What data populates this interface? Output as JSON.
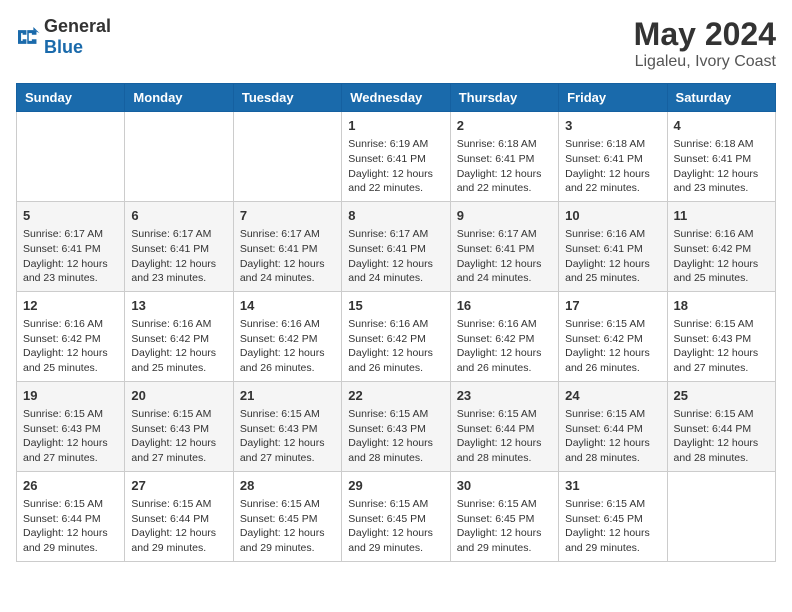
{
  "header": {
    "logo_general": "General",
    "logo_blue": "Blue",
    "month": "May 2024",
    "location": "Ligaleu, Ivory Coast"
  },
  "days_of_week": [
    "Sunday",
    "Monday",
    "Tuesday",
    "Wednesday",
    "Thursday",
    "Friday",
    "Saturday"
  ],
  "weeks": [
    [
      {
        "day": "",
        "info": ""
      },
      {
        "day": "",
        "info": ""
      },
      {
        "day": "",
        "info": ""
      },
      {
        "day": "1",
        "info": "Sunrise: 6:19 AM\nSunset: 6:41 PM\nDaylight: 12 hours\nand 22 minutes."
      },
      {
        "day": "2",
        "info": "Sunrise: 6:18 AM\nSunset: 6:41 PM\nDaylight: 12 hours\nand 22 minutes."
      },
      {
        "day": "3",
        "info": "Sunrise: 6:18 AM\nSunset: 6:41 PM\nDaylight: 12 hours\nand 22 minutes."
      },
      {
        "day": "4",
        "info": "Sunrise: 6:18 AM\nSunset: 6:41 PM\nDaylight: 12 hours\nand 23 minutes."
      }
    ],
    [
      {
        "day": "5",
        "info": "Sunrise: 6:17 AM\nSunset: 6:41 PM\nDaylight: 12 hours\nand 23 minutes."
      },
      {
        "day": "6",
        "info": "Sunrise: 6:17 AM\nSunset: 6:41 PM\nDaylight: 12 hours\nand 23 minutes."
      },
      {
        "day": "7",
        "info": "Sunrise: 6:17 AM\nSunset: 6:41 PM\nDaylight: 12 hours\nand 24 minutes."
      },
      {
        "day": "8",
        "info": "Sunrise: 6:17 AM\nSunset: 6:41 PM\nDaylight: 12 hours\nand 24 minutes."
      },
      {
        "day": "9",
        "info": "Sunrise: 6:17 AM\nSunset: 6:41 PM\nDaylight: 12 hours\nand 24 minutes."
      },
      {
        "day": "10",
        "info": "Sunrise: 6:16 AM\nSunset: 6:41 PM\nDaylight: 12 hours\nand 25 minutes."
      },
      {
        "day": "11",
        "info": "Sunrise: 6:16 AM\nSunset: 6:42 PM\nDaylight: 12 hours\nand 25 minutes."
      }
    ],
    [
      {
        "day": "12",
        "info": "Sunrise: 6:16 AM\nSunset: 6:42 PM\nDaylight: 12 hours\nand 25 minutes."
      },
      {
        "day": "13",
        "info": "Sunrise: 6:16 AM\nSunset: 6:42 PM\nDaylight: 12 hours\nand 25 minutes."
      },
      {
        "day": "14",
        "info": "Sunrise: 6:16 AM\nSunset: 6:42 PM\nDaylight: 12 hours\nand 26 minutes."
      },
      {
        "day": "15",
        "info": "Sunrise: 6:16 AM\nSunset: 6:42 PM\nDaylight: 12 hours\nand 26 minutes."
      },
      {
        "day": "16",
        "info": "Sunrise: 6:16 AM\nSunset: 6:42 PM\nDaylight: 12 hours\nand 26 minutes."
      },
      {
        "day": "17",
        "info": "Sunrise: 6:15 AM\nSunset: 6:42 PM\nDaylight: 12 hours\nand 26 minutes."
      },
      {
        "day": "18",
        "info": "Sunrise: 6:15 AM\nSunset: 6:43 PM\nDaylight: 12 hours\nand 27 minutes."
      }
    ],
    [
      {
        "day": "19",
        "info": "Sunrise: 6:15 AM\nSunset: 6:43 PM\nDaylight: 12 hours\nand 27 minutes."
      },
      {
        "day": "20",
        "info": "Sunrise: 6:15 AM\nSunset: 6:43 PM\nDaylight: 12 hours\nand 27 minutes."
      },
      {
        "day": "21",
        "info": "Sunrise: 6:15 AM\nSunset: 6:43 PM\nDaylight: 12 hours\nand 27 minutes."
      },
      {
        "day": "22",
        "info": "Sunrise: 6:15 AM\nSunset: 6:43 PM\nDaylight: 12 hours\nand 28 minutes."
      },
      {
        "day": "23",
        "info": "Sunrise: 6:15 AM\nSunset: 6:44 PM\nDaylight: 12 hours\nand 28 minutes."
      },
      {
        "day": "24",
        "info": "Sunrise: 6:15 AM\nSunset: 6:44 PM\nDaylight: 12 hours\nand 28 minutes."
      },
      {
        "day": "25",
        "info": "Sunrise: 6:15 AM\nSunset: 6:44 PM\nDaylight: 12 hours\nand 28 minutes."
      }
    ],
    [
      {
        "day": "26",
        "info": "Sunrise: 6:15 AM\nSunset: 6:44 PM\nDaylight: 12 hours\nand 29 minutes."
      },
      {
        "day": "27",
        "info": "Sunrise: 6:15 AM\nSunset: 6:44 PM\nDaylight: 12 hours\nand 29 minutes."
      },
      {
        "day": "28",
        "info": "Sunrise: 6:15 AM\nSunset: 6:45 PM\nDaylight: 12 hours\nand 29 minutes."
      },
      {
        "day": "29",
        "info": "Sunrise: 6:15 AM\nSunset: 6:45 PM\nDaylight: 12 hours\nand 29 minutes."
      },
      {
        "day": "30",
        "info": "Sunrise: 6:15 AM\nSunset: 6:45 PM\nDaylight: 12 hours\nand 29 minutes."
      },
      {
        "day": "31",
        "info": "Sunrise: 6:15 AM\nSunset: 6:45 PM\nDaylight: 12 hours\nand 29 minutes."
      },
      {
        "day": "",
        "info": ""
      }
    ]
  ]
}
